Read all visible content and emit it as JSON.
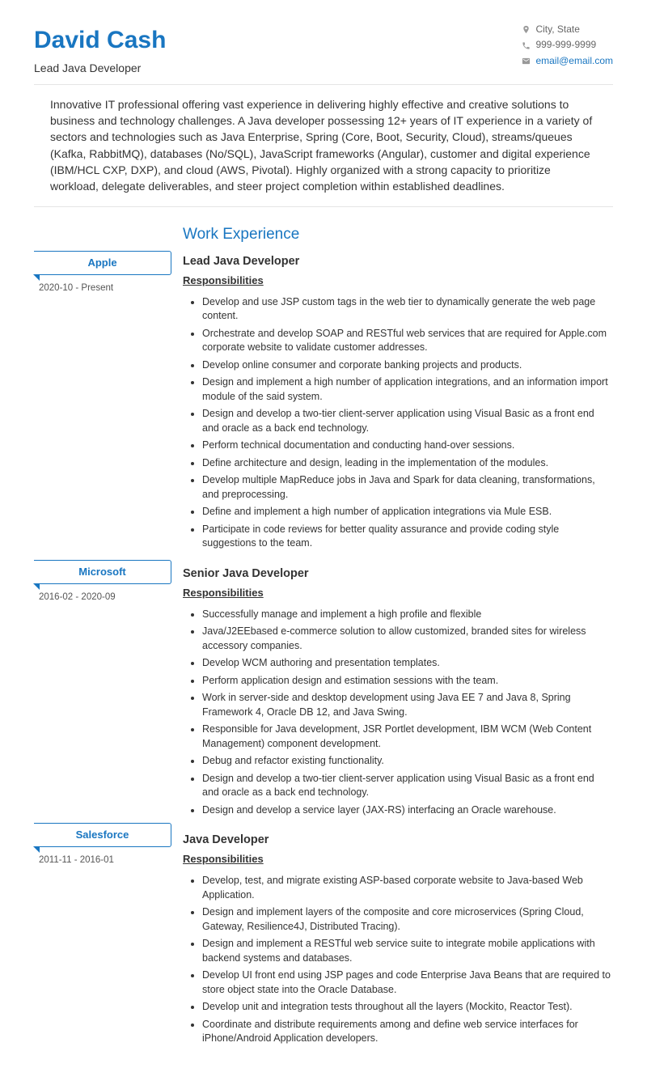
{
  "header": {
    "name": "David Cash",
    "title": "Lead Java Developer",
    "location": "City, State",
    "phone": "999-999-9999",
    "email": "email@email.com"
  },
  "summary": "Innovative IT professional offering vast experience in delivering highly effective and creative solutions to business and technology challenges. A Java developer possessing 12+ years of IT experience in a variety of sectors and technologies such as Java Enterprise, Spring (Core, Boot, Security, Cloud), streams/queues (Kafka, RabbitMQ), databases (No/SQL), JavaScript frameworks (Angular), customer and digital experience (IBM/HCL CXP, DXP), and cloud (AWS, Pivotal). Highly organized with a strong capacity to prioritize workload, delegate deliverables, and steer project completion within established deadlines.",
  "section_title": "Work Experience",
  "responsibilities_label": "Responsibilities",
  "jobs": [
    {
      "company": "Apple",
      "dates": "2020-10 - Present",
      "title": "Lead Java Developer",
      "bullets": [
        "Develop and use JSP custom tags in the web tier to dynamically generate the web page content.",
        "Orchestrate and develop SOAP and RESTful web services that are required for Apple.com corporate website to validate customer addresses.",
        "Develop online consumer and corporate banking projects and products.",
        "Design and implement a high number of application integrations, and an information import module of the said system.",
        "Design and develop a two-tier client-server application using Visual Basic as a front end and oracle as a back end technology.",
        "Perform technical documentation and conducting hand-over sessions.",
        "Define architecture and design, leading in the implementation of the modules.",
        "Develop multiple MapReduce jobs in Java and Spark for data cleaning, transformations, and preprocessing.",
        "Define and implement a high number of application integrations via Mule ESB.",
        "Participate in code reviews for better quality assurance and provide coding style suggestions to the team."
      ]
    },
    {
      "company": "Microsoft",
      "dates": "2016-02 - 2020-09",
      "title": "Senior Java Developer",
      "bullets": [
        "Successfully manage and implement a high profile and flexible",
        "Java/J2EEbased e-commerce solution to allow customized, branded sites for wireless accessory companies.",
        "Develop WCM authoring and presentation templates.",
        "Perform application design and estimation sessions with the team.",
        "Work in server-side and desktop development using Java EE 7 and Java 8, Spring Framework 4, Oracle DB 12, and Java Swing.",
        "Responsible for Java development, JSR Portlet development, IBM WCM (Web Content Management) component development.",
        "Debug and refactor existing functionality.",
        "Design and develop a two-tier client-server application using Visual Basic as a front end and oracle as a back end technology.",
        "Design and develop a service layer (JAX-RS) interfacing an Oracle warehouse."
      ]
    },
    {
      "company": "Salesforce",
      "dates": "2011-11 - 2016-01",
      "title": "Java Developer",
      "bullets": [
        "Develop, test, and migrate existing ASP-based corporate website to Java-based Web Application.",
        "Design and implement layers of the composite and core microservices (Spring Cloud, Gateway, Resilience4J, Distributed Tracing).",
        "Design and implement a RESTful web service suite to integrate mobile applications with backend systems and databases.",
        "Develop UI front end using JSP pages and code Enterprise Java Beans that are required to store object state into the Oracle Database.",
        "Develop unit and integration tests throughout all the layers (Mockito, Reactor Test).",
        "Coordinate and distribute requirements among and define web service interfaces for iPhone/Android Application developers."
      ]
    }
  ]
}
